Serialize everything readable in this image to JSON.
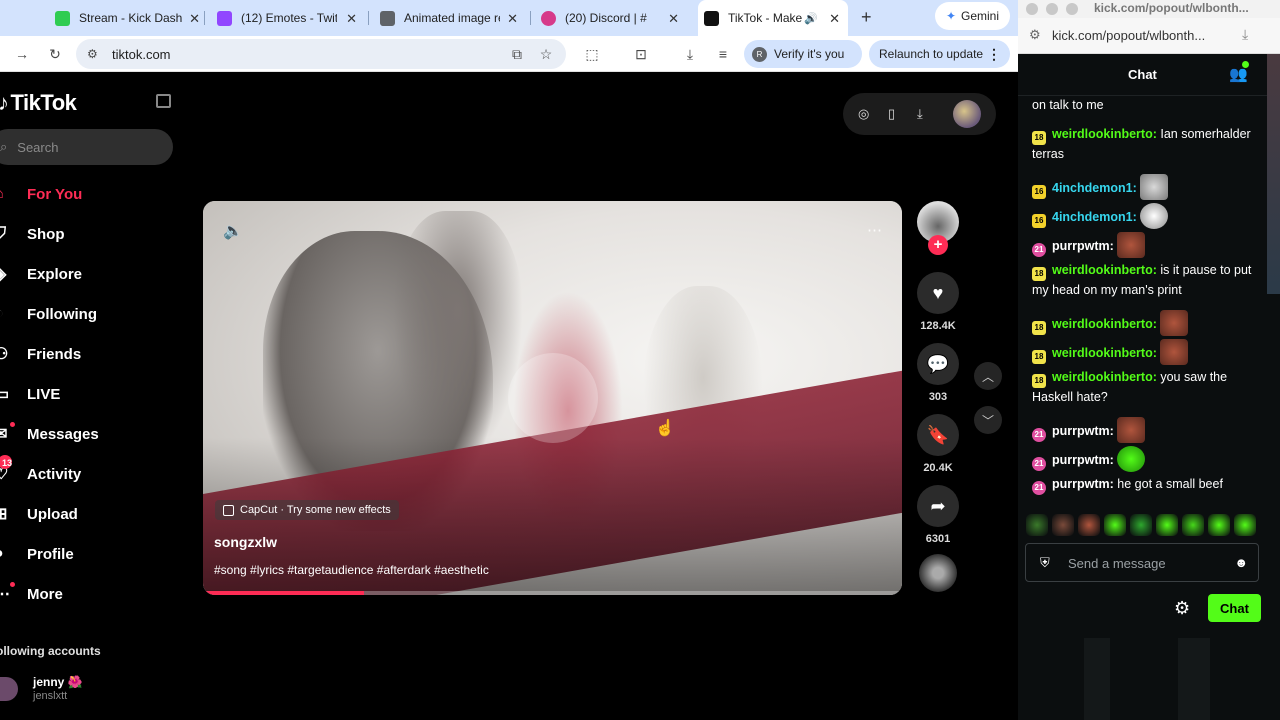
{
  "tabs": [
    {
      "title": "Stream - Kick Dash",
      "color": "#2fcc52"
    },
    {
      "title": "(12) Emotes - Twitc",
      "color": "#9146ff"
    },
    {
      "title": "Animated image re",
      "color": "#5f6368"
    },
    {
      "title": "(20) Discord | #",
      "color": "#d63a8a"
    },
    {
      "title": "TikTok - Make",
      "color": "#111111"
    }
  ],
  "gemini_label": "Gemini",
  "url": "tiktok.com",
  "verify_label": "Verify it's you",
  "verify_initial": "R",
  "relaunch_label": "Relaunch to update",
  "tiktok": {
    "logo": "TikTok",
    "search_placeholder": "Search",
    "nav": [
      {
        "label": "For You",
        "icon": "home-icon",
        "selected": true
      },
      {
        "label": "Shop",
        "icon": "bag-icon"
      },
      {
        "label": "Explore",
        "icon": "compass-icon"
      },
      {
        "label": "Following",
        "icon": "following-icon"
      },
      {
        "label": "Friends",
        "icon": "friends-icon"
      },
      {
        "label": "LIVE",
        "icon": "live-icon"
      },
      {
        "label": "Messages",
        "icon": "message-icon"
      },
      {
        "label": "Activity",
        "icon": "activity-icon",
        "badge": "13"
      },
      {
        "label": "Upload",
        "icon": "upload-icon"
      },
      {
        "label": "Profile",
        "icon": "profile-icon"
      },
      {
        "label": "More",
        "icon": "more-icon"
      }
    ],
    "following_header": "ollowing accounts",
    "following_account": {
      "name": "jenny 🌺",
      "handle": "jenslxtt"
    },
    "video": {
      "capcut": "CapCut · Try some new effects",
      "author": "songzxlw",
      "description": "#song #lyrics #targetaudience #afterdark #aesthetic",
      "progress": 0.23
    },
    "actions": {
      "likes": "128.4K",
      "comments": "303",
      "saves": "20.4K",
      "shares": "6301"
    }
  },
  "kick": {
    "window_title": "kick.com/popout/wlbonth...",
    "url": "kick.com/popout/wlbonth...",
    "chat_title": "Chat",
    "messages": [
      {
        "badge": "",
        "user": "",
        "user_color": "",
        "text": "on talk to me",
        "emote": ""
      },
      {
        "badge": "18",
        "badge_class": "b18",
        "user": "weirdlookinberto:",
        "user_color": "#53fc18",
        "text": "Ian somerhalder terras",
        "emote": ""
      },
      {
        "badge": "16",
        "badge_class": "b16",
        "user": "4inchdemon1:",
        "user_color": "#37d7ef",
        "text": "",
        "emote": "e-cat"
      },
      {
        "badge": "16",
        "badge_class": "b16",
        "user": "4inchdemon1:",
        "user_color": "#37d7ef",
        "text": "",
        "emote": "e-ghost"
      },
      {
        "badge": "21",
        "badge_class": "b21",
        "user": "purrpwtm:",
        "user_color": "#ffffff",
        "text": "",
        "emote": "e-face"
      },
      {
        "badge": "18",
        "badge_class": "b18",
        "user": "weirdlookinberto:",
        "user_color": "#53fc18",
        "text": "is it pause to put my head on my man's print",
        "emote": ""
      },
      {
        "badge": "18",
        "badge_class": "b18",
        "user": "weirdlookinberto:",
        "user_color": "#53fc18",
        "text": "",
        "emote": "e-face"
      },
      {
        "badge": "18",
        "badge_class": "b18",
        "user": "weirdlookinberto:",
        "user_color": "#53fc18",
        "text": "",
        "emote": "e-face"
      },
      {
        "badge": "18",
        "badge_class": "b18",
        "user": "weirdlookinberto:",
        "user_color": "#53fc18",
        "text": "you saw the Haskell hate?",
        "emote": ""
      },
      {
        "badge": "21",
        "badge_class": "b21",
        "user": "purrpwtm:",
        "user_color": "#ffffff",
        "text": "",
        "emote": "e-face"
      },
      {
        "badge": "21",
        "badge_class": "b21",
        "user": "purrpwtm:",
        "user_color": "#ffffff",
        "text": "",
        "emote": "e-green"
      },
      {
        "badge": "21",
        "badge_class": "b21",
        "user": "purrpwtm:",
        "user_color": "#ffffff",
        "text": "he got a small beef",
        "emote": ""
      }
    ],
    "emote_bar": [
      "#3a7a2a",
      "#7a4a3a",
      "#b0553d",
      "#53fc18",
      "#2ea82e",
      "#53fc18",
      "#46d81a",
      "#53fc18",
      "#53fc18"
    ],
    "input_placeholder": "Send a message",
    "chat_button": "Chat"
  }
}
